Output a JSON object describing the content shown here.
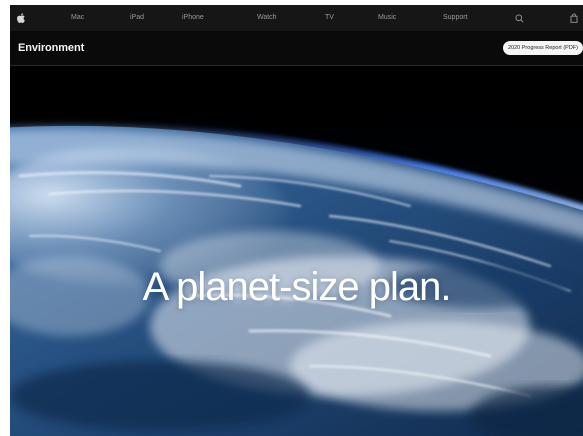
{
  "globalnav": {
    "apple_icon": "apple-logo-icon",
    "items": [
      {
        "label": "Mac"
      },
      {
        "label": "iPad"
      },
      {
        "label": "iPhone"
      },
      {
        "label": "Watch"
      },
      {
        "label": "TV"
      },
      {
        "label": "Music"
      },
      {
        "label": "Support"
      }
    ],
    "search_icon": "search-icon",
    "bag_icon": "shopping-bag-icon"
  },
  "localnav": {
    "title": "Environment",
    "cta_label": "2020 Progress Report (PDF)"
  },
  "hero": {
    "headline": "A planet-size plan."
  },
  "colors": {
    "nav_background": "#161617",
    "nav_text": "#9a9a9f",
    "page_background": "#000000",
    "headline": "#ffffff"
  }
}
